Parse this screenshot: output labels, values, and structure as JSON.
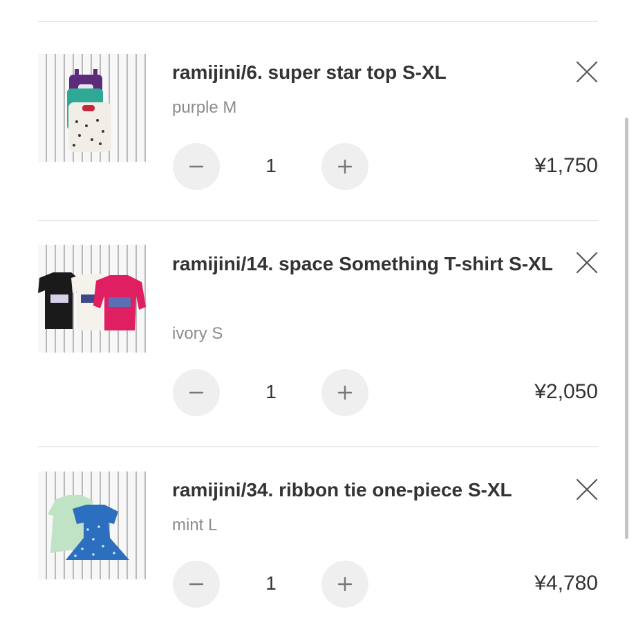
{
  "cart": {
    "items": [
      {
        "title": "ramijini/6. super star top S-XL",
        "variant": "purple M",
        "quantity": "1",
        "price": "¥1,750",
        "thumb_alt": "super star top product photo"
      },
      {
        "title": "ramijini/14. space Something T-shirt S-XL",
        "variant": "ivory S",
        "quantity": "1",
        "price": "¥2,050",
        "thumb_alt": "space Something T-shirt product photo"
      },
      {
        "title": "ramijini/34. ribbon tie one-piece S-XL",
        "variant": "mint L",
        "quantity": "1",
        "price": "¥4,780",
        "thumb_alt": "ribbon tie one-piece product photo"
      }
    ]
  },
  "icons": {
    "remove": "close-icon",
    "decrease": "minus-icon",
    "increase": "plus-icon"
  },
  "colors": {
    "text": "#333333",
    "muted": "#8c8c8c",
    "button_bg": "#efefef",
    "divider": "#e9e9e9"
  }
}
